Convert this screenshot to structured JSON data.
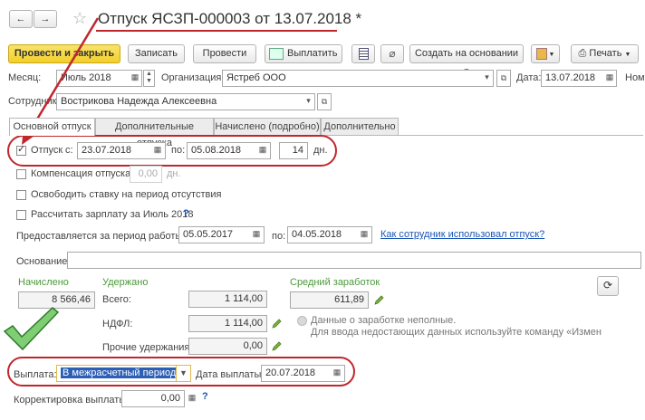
{
  "title": "Отпуск ЯСЗП-000003 от 13.07.2018 *",
  "nav": {
    "back": "←",
    "forward": "→",
    "star": "☆"
  },
  "toolbar": {
    "post_close": "Провести и закрыть",
    "save": "Записать",
    "post": "Провести",
    "pay": "Выплатить",
    "create_based": "Создать на основании",
    "print": "Печать"
  },
  "header": {
    "month_label": "Месяц:",
    "month_value": "Июль 2018",
    "org_label": "Организация:",
    "org_value": "Ястреб ООО",
    "date_label": "Дата:",
    "date_value": "13.07.2018",
    "num_label": "Ном",
    "employee_label": "Сотрудник:",
    "employee_value": "Вострикова Надежда Алексеевна"
  },
  "tabs": [
    {
      "label": "Основной отпуск"
    },
    {
      "label": "Дополнительные отпуска"
    },
    {
      "label": "Начислено (подробно)"
    },
    {
      "label": "Дополнительно"
    }
  ],
  "vacation": {
    "checkbox_label": "Отпуск",
    "from_label": "с:",
    "from_value": "23.07.2018",
    "to_label": "по:",
    "to_value": "05.08.2018",
    "days_value": "14",
    "days_unit": "дн."
  },
  "options": {
    "compensation_label": "Компенсация отпуска",
    "compensation_value": "0,00",
    "compensation_unit": "дн.",
    "free_rate_label": "Освободить ставку на период отсутствия",
    "calc_salary_label": "Рассчитать зарплату за Июль 2018",
    "help": "?"
  },
  "work_period": {
    "label": "Предоставляется за период работы с:",
    "from_value": "05.05.2017",
    "to_label": "по:",
    "to_value": "04.05.2018",
    "link": "Как сотрудник использовал отпуск?"
  },
  "basis": {
    "label": "Основание:",
    "value": ""
  },
  "accrued": {
    "title": "Начислено",
    "value": "8 566,46"
  },
  "withheld": {
    "title": "Удержано",
    "total_label": "Всего:",
    "total_value": "1 114,00",
    "ndfl_label": "НДФЛ:",
    "ndfl_value": "1 114,00",
    "other_label": "Прочие удержания:",
    "other_value": "0,00"
  },
  "avg_earnings": {
    "title": "Средний заработок",
    "value": "611,89",
    "note_line1": "Данные о заработке неполные.",
    "note_line2": "Для ввода недостающих данных используйте команду «Измен"
  },
  "payment": {
    "label": "Выплата:",
    "value": "В межрасчетный период",
    "date_label": "Дата выплаты:",
    "date_value": "20.07.2018"
  },
  "correction": {
    "label": "Корректировка выплаты:",
    "value": "0,00",
    "help": "?"
  },
  "colors": {
    "annotation_red": "#c0272d",
    "accent_green": "#4a9a3a",
    "link_blue": "#1a55b5",
    "primary_yellow": "#f4d43a"
  }
}
